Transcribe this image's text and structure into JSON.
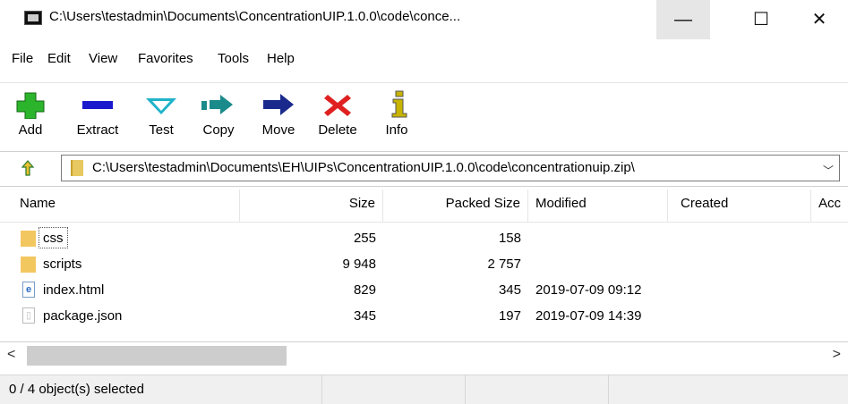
{
  "window": {
    "title": "C:\\Users\\testadmin\\Documents\\ConcentrationUIP.1.0.0\\code\\conce...",
    "minimize_glyph": "—",
    "maximize_glyph": "☐",
    "close_glyph": "✕"
  },
  "menu": [
    "File",
    "Edit",
    "View",
    "Favorites",
    "Tools",
    "Help"
  ],
  "toolbar": [
    {
      "label": "Add",
      "icon": "add-icon",
      "color": "#2cb52c"
    },
    {
      "label": "Extract",
      "icon": "extract-icon",
      "color": "#1a1acc"
    },
    {
      "label": "Test",
      "icon": "test-icon",
      "color": "#1fb3c9"
    },
    {
      "label": "Copy",
      "icon": "copy-icon",
      "color": "#1b8a8a"
    },
    {
      "label": "Move",
      "icon": "move-icon",
      "color": "#1a2a8c"
    },
    {
      "label": "Delete",
      "icon": "delete-icon",
      "color": "#e02020"
    },
    {
      "label": "Info",
      "icon": "info-icon",
      "color": "#c8b400"
    }
  ],
  "address": {
    "path": "C:\\Users\\testadmin\\Documents\\EH\\UIPs\\ConcentrationUIP.1.0.0\\code\\concentrationuip.zip\\"
  },
  "columns": [
    "Name",
    "Size",
    "Packed Size",
    "Modified",
    "Created",
    "Acc"
  ],
  "files": [
    {
      "name": "css",
      "size": "255",
      "packed": "158",
      "modified": "",
      "type": "folder"
    },
    {
      "name": "scripts",
      "size": "9 948",
      "packed": "2 757",
      "modified": "",
      "type": "folder"
    },
    {
      "name": "index.html",
      "size": "829",
      "packed": "345",
      "modified": "2019-07-09 09:12",
      "type": "html"
    },
    {
      "name": "package.json",
      "size": "345",
      "packed": "197",
      "modified": "2019-07-09 14:39",
      "type": "json"
    }
  ],
  "status": {
    "selection": "0 / 4 object(s) selected"
  }
}
